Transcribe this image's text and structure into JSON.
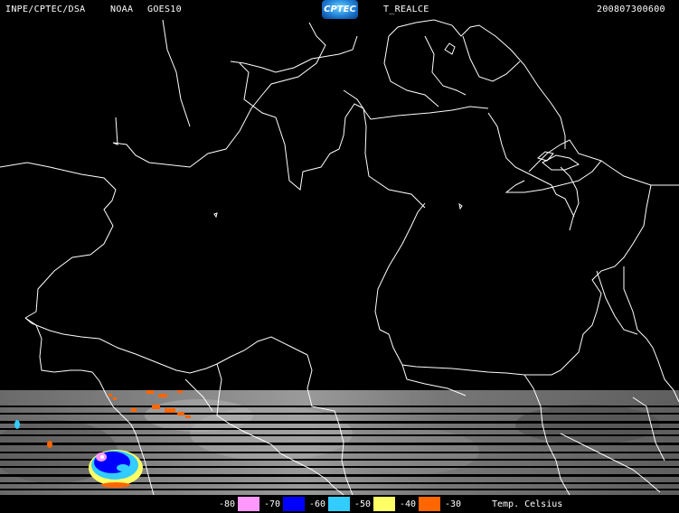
{
  "header": {
    "source": "INPE/CPTEC/DSA",
    "agency": "NOAA",
    "satellite": "GOES10",
    "logo_text": "CPTEC",
    "product": "T_REALCE",
    "timestamp": "200807300600"
  },
  "colors": {
    "background": "#000000",
    "border_lines": "#ffffff",
    "cloud_gray": "#5a5a5a"
  },
  "legend": {
    "title": "Temp. Celsius",
    "entries": [
      {
        "label": "-80",
        "color": "#ff99ff"
      },
      {
        "label": "-70",
        "color": "#0000ff"
      },
      {
        "label": "-60",
        "color": "#33ccff"
      },
      {
        "label": "-50",
        "color": "#ffff66"
      },
      {
        "label": "-40",
        "color": "#ff6600"
      },
      {
        "label": "-30",
        "color": "#000000"
      }
    ]
  }
}
